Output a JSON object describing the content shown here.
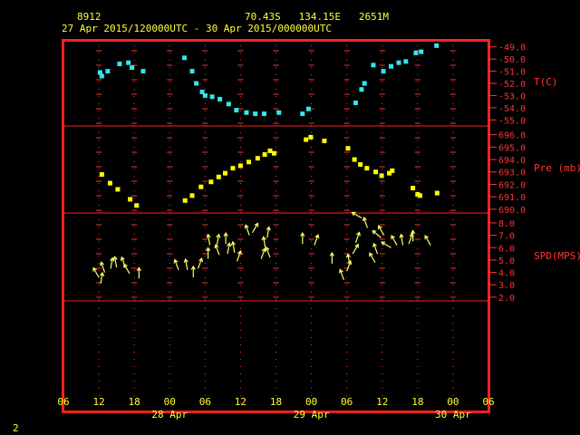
{
  "header": {
    "station_id": "8912",
    "location": "70.43S   134.15E   2651M",
    "time_range": "27 Apr 2015/120000UTC - 30 Apr 2015/000000UTC"
  },
  "footer": {
    "page_number": "2"
  },
  "colors": {
    "frame": "#ff2020",
    "temperature": "#33e6f0",
    "pressure": "#ffff00",
    "wind": "#ffff66",
    "labels": "#ffff33",
    "ticks": "#ff3333"
  },
  "chart_data": [
    {
      "type": "scatter",
      "name": "temperature",
      "ylabel": "T(C)",
      "ylim": [
        -55.5,
        -48.5
      ],
      "yticks": [
        "-49.0",
        "-50.0",
        "-51.0",
        "-52.0",
        "-53.0",
        "-54.0",
        "-55.0"
      ],
      "points": [
        {
          "x": 12.2,
          "y": -51.1
        },
        {
          "x": 12.5,
          "y": -51.4
        },
        {
          "x": 13.5,
          "y": -51.0
        },
        {
          "x": 15.5,
          "y": -50.4
        },
        {
          "x": 17.0,
          "y": -50.3
        },
        {
          "x": 17.6,
          "y": -50.7
        },
        {
          "x": 19.5,
          "y": -51.0
        },
        {
          "x": 26.5,
          "y": -49.9
        },
        {
          "x": 27.8,
          "y": -51.0
        },
        {
          "x": 28.5,
          "y": -52.0
        },
        {
          "x": 29.5,
          "y": -52.7
        },
        {
          "x": 30.0,
          "y": -53.0
        },
        {
          "x": 31.2,
          "y": -53.1
        },
        {
          "x": 32.5,
          "y": -53.3
        },
        {
          "x": 34.0,
          "y": -53.7
        },
        {
          "x": 35.3,
          "y": -54.2
        },
        {
          "x": 37.0,
          "y": -54.4
        },
        {
          "x": 38.5,
          "y": -54.5
        },
        {
          "x": 40.0,
          "y": -54.5
        },
        {
          "x": 42.5,
          "y": -54.4
        },
        {
          "x": 46.5,
          "y": -54.5
        },
        {
          "x": 47.5,
          "y": -54.1
        },
        {
          "x": 55.5,
          "y": -53.6
        },
        {
          "x": 56.5,
          "y": -52.5
        },
        {
          "x": 57.0,
          "y": -52.0
        },
        {
          "x": 58.5,
          "y": -50.5
        },
        {
          "x": 60.2,
          "y": -51.0
        },
        {
          "x": 61.5,
          "y": -50.6
        },
        {
          "x": 62.8,
          "y": -50.3
        },
        {
          "x": 64.0,
          "y": -50.2
        },
        {
          "x": 65.7,
          "y": -49.5
        },
        {
          "x": 66.6,
          "y": -49.4
        },
        {
          "x": 69.2,
          "y": -48.9
        }
      ]
    },
    {
      "type": "scatter",
      "name": "pressure",
      "ylabel": "Pre (mb)",
      "ylim": [
        689.7,
        696.7
      ],
      "yticks": [
        "696.0",
        "695.0",
        "694.0",
        "693.0",
        "692.0",
        "691.0",
        "690.0"
      ],
      "points": [
        {
          "x": 12.5,
          "y": 692.8
        },
        {
          "x": 13.9,
          "y": 692.1
        },
        {
          "x": 15.2,
          "y": 691.6
        },
        {
          "x": 17.3,
          "y": 690.8
        },
        {
          "x": 18.4,
          "y": 690.3
        },
        {
          "x": 26.6,
          "y": 690.7
        },
        {
          "x": 27.8,
          "y": 691.1
        },
        {
          "x": 29.3,
          "y": 691.8
        },
        {
          "x": 31.0,
          "y": 692.2
        },
        {
          "x": 32.3,
          "y": 692.6
        },
        {
          "x": 33.4,
          "y": 692.9
        },
        {
          "x": 34.7,
          "y": 693.3
        },
        {
          "x": 36.0,
          "y": 693.5
        },
        {
          "x": 37.4,
          "y": 693.8
        },
        {
          "x": 38.9,
          "y": 694.1
        },
        {
          "x": 40.1,
          "y": 694.4
        },
        {
          "x": 41.0,
          "y": 694.7
        },
        {
          "x": 41.7,
          "y": 694.5
        },
        {
          "x": 47.1,
          "y": 695.6
        },
        {
          "x": 47.9,
          "y": 695.8
        },
        {
          "x": 50.2,
          "y": 695.5
        },
        {
          "x": 54.2,
          "y": 694.9
        },
        {
          "x": 55.3,
          "y": 694.0
        },
        {
          "x": 56.3,
          "y": 693.6
        },
        {
          "x": 57.4,
          "y": 693.3
        },
        {
          "x": 58.9,
          "y": 693.0
        },
        {
          "x": 59.9,
          "y": 692.7
        },
        {
          "x": 61.2,
          "y": 692.9
        },
        {
          "x": 61.7,
          "y": 693.1
        },
        {
          "x": 65.2,
          "y": 691.7
        },
        {
          "x": 66.0,
          "y": 691.2
        },
        {
          "x": 66.4,
          "y": 691.1
        },
        {
          "x": 69.3,
          "y": 691.3
        }
      ]
    },
    {
      "type": "scatter",
      "name": "wind",
      "ylabel": "SPD(MPS)",
      "ylim": [
        1.7,
        8.8
      ],
      "yticks": [
        "8.0",
        "7.0",
        "6.0",
        "5.0",
        "4.0",
        "3.0",
        "2.0"
      ],
      "points": [
        {
          "x": 12.0,
          "y": 3.6,
          "dir": 330
        },
        {
          "x": 12.3,
          "y": 3.1,
          "dir": 10
        },
        {
          "x": 13.0,
          "y": 4.0,
          "dir": 340
        },
        {
          "x": 14.0,
          "y": 4.3,
          "dir": 10
        },
        {
          "x": 15.0,
          "y": 4.4,
          "dir": 350
        },
        {
          "x": 16.5,
          "y": 4.4,
          "dir": 340
        },
        {
          "x": 17.2,
          "y": 3.9,
          "dir": 330
        },
        {
          "x": 18.8,
          "y": 3.5,
          "dir": 0
        },
        {
          "x": 25.5,
          "y": 4.2,
          "dir": 340
        },
        {
          "x": 27.0,
          "y": 4.2,
          "dir": 350
        },
        {
          "x": 28.0,
          "y": 3.6,
          "dir": 0
        },
        {
          "x": 28.8,
          "y": 4.3,
          "dir": 20
        },
        {
          "x": 30.5,
          "y": 5.1,
          "dir": 0
        },
        {
          "x": 30.8,
          "y": 6.2,
          "dir": 350
        },
        {
          "x": 32.0,
          "y": 6.2,
          "dir": 10
        },
        {
          "x": 32.4,
          "y": 5.4,
          "dir": 340
        },
        {
          "x": 33.5,
          "y": 6.3,
          "dir": 0
        },
        {
          "x": 33.8,
          "y": 5.5,
          "dir": 10
        },
        {
          "x": 35.0,
          "y": 5.6,
          "dir": 350
        },
        {
          "x": 35.4,
          "y": 4.9,
          "dir": 20
        },
        {
          "x": 37.5,
          "y": 7.0,
          "dir": 340
        },
        {
          "x": 38.0,
          "y": 7.2,
          "dir": 30
        },
        {
          "x": 39.5,
          "y": 5.1,
          "dir": 20
        },
        {
          "x": 40.2,
          "y": 6.0,
          "dir": 350
        },
        {
          "x": 40.5,
          "y": 6.8,
          "dir": 10
        },
        {
          "x": 41.0,
          "y": 5.2,
          "dir": 340
        },
        {
          "x": 46.5,
          "y": 6.3,
          "dir": 0
        },
        {
          "x": 48.5,
          "y": 6.2,
          "dir": 20
        },
        {
          "x": 51.5,
          "y": 4.7,
          "dir": 0
        },
        {
          "x": 53.5,
          "y": 3.4,
          "dir": 340
        },
        {
          "x": 54.0,
          "y": 4.1,
          "dir": 20
        },
        {
          "x": 54.5,
          "y": 4.6,
          "dir": 350
        },
        {
          "x": 55.0,
          "y": 5.5,
          "dir": 30
        },
        {
          "x": 55.5,
          "y": 6.4,
          "dir": 20
        },
        {
          "x": 56.5,
          "y": 8.4,
          "dir": 300
        },
        {
          "x": 57.5,
          "y": 7.6,
          "dir": 340
        },
        {
          "x": 58.8,
          "y": 4.8,
          "dir": 330
        },
        {
          "x": 59.2,
          "y": 5.5,
          "dir": 340
        },
        {
          "x": 59.8,
          "y": 6.8,
          "dir": 310
        },
        {
          "x": 60.3,
          "y": 7.0,
          "dir": 330
        },
        {
          "x": 61.5,
          "y": 6.0,
          "dir": 300
        },
        {
          "x": 62.5,
          "y": 6.2,
          "dir": 330
        },
        {
          "x": 63.5,
          "y": 6.2,
          "dir": 350
        },
        {
          "x": 64.5,
          "y": 6.3,
          "dir": 20
        },
        {
          "x": 65.2,
          "y": 6.5,
          "dir": 0
        },
        {
          "x": 68.2,
          "y": 6.2,
          "dir": 330
        }
      ]
    }
  ],
  "x_axis": {
    "range_hours": [
      6,
      78
    ],
    "tick_hours": [
      6,
      12,
      18,
      24,
      30,
      36,
      42,
      48,
      54,
      60,
      66,
      72,
      78
    ],
    "tick_labels": [
      "06",
      "12",
      "18",
      "00",
      "06",
      "12",
      "18",
      "00",
      "06",
      "12",
      "18",
      "00",
      "06"
    ],
    "date_labels": [
      {
        "hour": 24,
        "text": "28 Apr"
      },
      {
        "hour": 48,
        "text": "29 Apr"
      },
      {
        "hour": 72,
        "text": "30 Apr"
      }
    ]
  }
}
